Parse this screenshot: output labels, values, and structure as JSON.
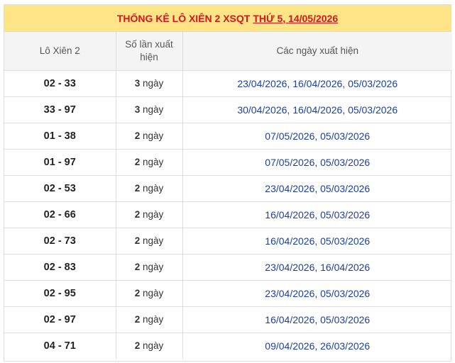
{
  "title": {
    "main": "THỐNG KÊ LÔ XIÊN 2 XSQT",
    "date_link": "THỨ 5, 14/05/2026"
  },
  "headers": {
    "col1": "Lô Xiên 2",
    "col2": "Số lần xuất hiện",
    "col3": "Các ngày xuất hiện"
  },
  "rows": [
    {
      "pair": "02 - 33",
      "count_num": "3",
      "count_unit": "ngày",
      "dates": [
        "23/04/2026",
        "16/04/2026",
        "05/03/2026"
      ]
    },
    {
      "pair": "33 - 97",
      "count_num": "3",
      "count_unit": "ngày",
      "dates": [
        "30/04/2026",
        "16/04/2026",
        "05/03/2026"
      ]
    },
    {
      "pair": "01 - 38",
      "count_num": "2",
      "count_unit": "ngày",
      "dates": [
        "07/05/2026",
        "05/03/2026"
      ]
    },
    {
      "pair": "01 - 97",
      "count_num": "2",
      "count_unit": "ngày",
      "dates": [
        "07/05/2026",
        "05/03/2026"
      ]
    },
    {
      "pair": "02 - 53",
      "count_num": "2",
      "count_unit": "ngày",
      "dates": [
        "23/04/2026",
        "05/03/2026"
      ]
    },
    {
      "pair": "02 - 66",
      "count_num": "2",
      "count_unit": "ngày",
      "dates": [
        "16/04/2026",
        "05/03/2026"
      ]
    },
    {
      "pair": "02 - 73",
      "count_num": "2",
      "count_unit": "ngày",
      "dates": [
        "16/04/2026",
        "05/03/2026"
      ]
    },
    {
      "pair": "02 - 83",
      "count_num": "2",
      "count_unit": "ngày",
      "dates": [
        "23/04/2026",
        "16/04/2026"
      ]
    },
    {
      "pair": "02 - 95",
      "count_num": "2",
      "count_unit": "ngày",
      "dates": [
        "23/04/2026",
        "05/03/2026"
      ]
    },
    {
      "pair": "02 - 97",
      "count_num": "2",
      "count_unit": "ngày",
      "dates": [
        "16/04/2026",
        "05/03/2026"
      ]
    },
    {
      "pair": "04 - 71",
      "count_num": "2",
      "count_unit": "ngày",
      "dates": [
        "09/04/2026",
        "26/03/2026"
      ]
    }
  ],
  "colors": {
    "title_bg": "#fde486",
    "title_text": "#d9151b",
    "header_bg": "#f4f4f4",
    "date_link": "#1a3fa6",
    "border": "#dddddd"
  }
}
